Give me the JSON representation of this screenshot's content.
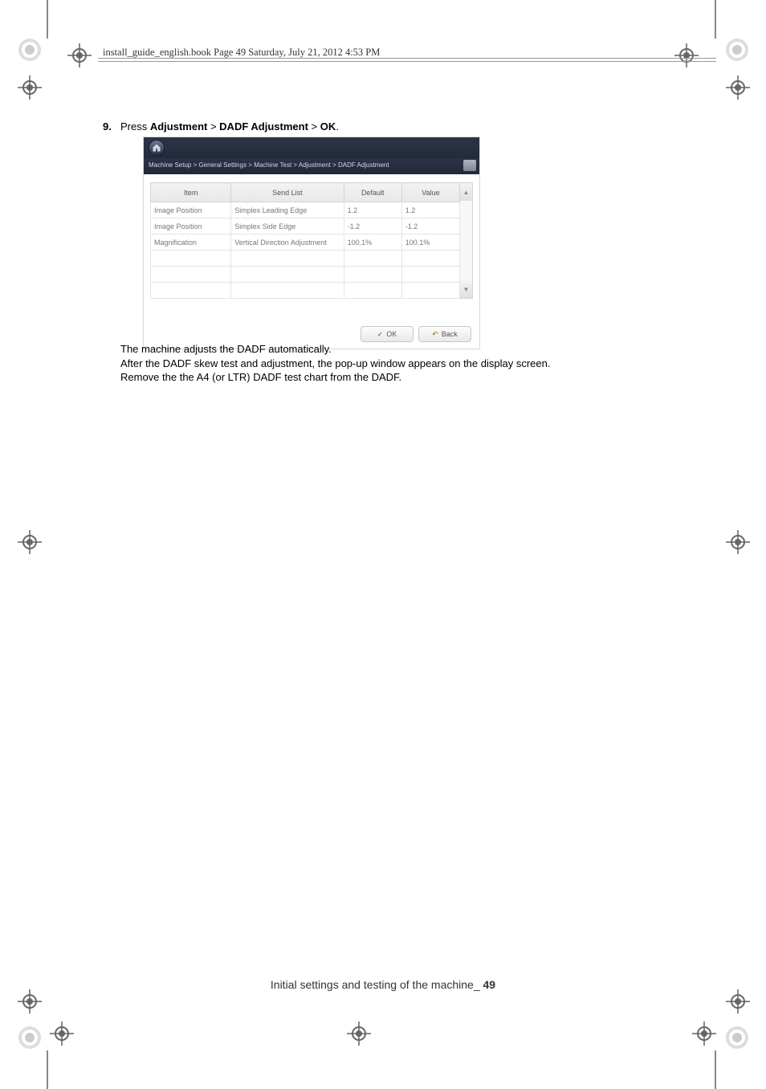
{
  "header": {
    "running_head": "install_guide_english.book  Page 49  Saturday, July 21, 2012  4:53 PM"
  },
  "step": {
    "number": "9.",
    "prefix": "Press ",
    "b1": "Adjustment",
    "sep1": " > ",
    "b2": "DADF Adjustment",
    "sep2": " > ",
    "b3": "OK",
    "suffix": "."
  },
  "shot": {
    "breadcrumb": "Machine Setup > General Settings > Machine Test > Adjustment > DADF Adjustment",
    "headers": {
      "item": "Item",
      "send": "Send List",
      "def": "Default",
      "val": "Value"
    },
    "rows": [
      {
        "item": "Image Position",
        "send": "Simplex Leading Edge",
        "def": "1.2",
        "val": "1.2"
      },
      {
        "item": "Image Position",
        "send": "Simplex Side Edge",
        "def": "-1.2",
        "val": "-1.2"
      },
      {
        "item": "Magnification",
        "send": "Vertical Direction Adjustment",
        "def": "100.1%",
        "val": "100.1%"
      }
    ],
    "ok_label": "OK",
    "back_label": "Back"
  },
  "body": {
    "line1": "The machine adjusts the DADF automatically.",
    "line2": "After the DADF skew test and adjustment, the pop-up window appears on the display screen.",
    "line3": "Remove the the A4 (or LTR) DADF test chart from the DADF."
  },
  "footer": {
    "chapter": "Initial settings and testing of the machine",
    "sep": "_ ",
    "page": "49"
  }
}
